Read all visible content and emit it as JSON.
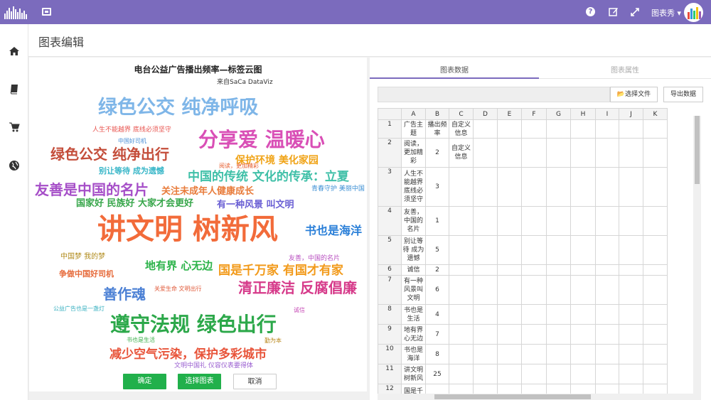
{
  "header": {
    "user_name": "图表秀",
    "help_icon": "question-circle-icon",
    "edit_icon": "edit-icon",
    "expand_icon": "expand-icon"
  },
  "sidebar": {
    "items": [
      {
        "icon": "home-icon"
      },
      {
        "icon": "book-icon"
      },
      {
        "icon": "cart-icon"
      },
      {
        "icon": "globe-icon"
      }
    ]
  },
  "page": {
    "title": "图表编辑"
  },
  "chart": {
    "title": "电台公益广告播出频率—标签云图",
    "subtitle": "来自SaCa DataViz"
  },
  "chart_data": {
    "type": "wordcloud",
    "title": "电台公益广告播出频率—标签云图",
    "words": [
      {
        "text": "绿色公交 纯净呼吸",
        "color": "#7fb6e8"
      },
      {
        "text": "人生不能越界 底线必须坚守",
        "color": "#e8544f"
      },
      {
        "text": "分享爱 温暖心",
        "color": "#d94fb6"
      },
      {
        "text": "中国好司机",
        "color": "#4a8fd6"
      },
      {
        "text": "绿色公交 纯净出行",
        "color": "#c44d3a"
      },
      {
        "text": "保护环境 美化家园",
        "color": "#f0a418"
      },
      {
        "text": "阅读，更加精彩",
        "color": "#e65e2f"
      },
      {
        "text": "别让等待 成为遗憾",
        "color": "#38b6c8"
      },
      {
        "text": "中国的传统 文化的传承：立夏",
        "color": "#40c0a8"
      },
      {
        "text": "友善是中国的名片",
        "color": "#a64fc8"
      },
      {
        "text": "关注未成年人健康成长",
        "color": "#e87b3a"
      },
      {
        "text": "青春守护 美丽中国",
        "color": "#3c8fd4"
      },
      {
        "text": "国家好 民族好 大家才会更好",
        "color": "#37a64a"
      },
      {
        "text": "有一种风景 叫文明",
        "color": "#6a5fd4"
      },
      {
        "text": "讲文明 树新风",
        "color": "#f26b3a"
      },
      {
        "text": "书也是海洋",
        "color": "#2a7fd8"
      },
      {
        "text": "中国梦 我的梦",
        "color": "#b08a1a"
      },
      {
        "text": "友善，中国的名片",
        "color": "#b84fc0"
      },
      {
        "text": "地有界 心无边",
        "color": "#2cb34a"
      },
      {
        "text": "国是千万家 有国才有家",
        "color": "#f29a1a"
      },
      {
        "text": "争做中国好司机",
        "color": "#e66a3a"
      },
      {
        "text": "清正廉洁 反腐倡廉",
        "color": "#d63a8a"
      },
      {
        "text": "关爱生命 文明出行",
        "color": "#e05a3a"
      },
      {
        "text": "善作魂",
        "color": "#4a7fd4"
      },
      {
        "text": "公益广告也是一盏灯",
        "color": "#38b0c0"
      },
      {
        "text": "诚信",
        "color": "#c850b8"
      },
      {
        "text": "遵守法规 绿色出行",
        "color": "#2ca84a"
      },
      {
        "text": "书也是生活",
        "color": "#3ab04a"
      },
      {
        "text": "勤为本",
        "color": "#b8861a"
      },
      {
        "text": "减少空气污染，保护多彩城市",
        "color": "#e8543a"
      },
      {
        "text": "文明中国礼 仪容仪表要得体",
        "color": "#9a5fd0"
      }
    ]
  },
  "buttons": {
    "ok": "确定",
    "select_chart": "选择图表",
    "cancel": "取消"
  },
  "data_panel": {
    "tab_data": "图表数据",
    "tab_props": "图表属性",
    "select_file": "选择文件",
    "export": "导出数据",
    "columns": [
      "A",
      "B",
      "C",
      "D",
      "E",
      "F",
      "G",
      "H",
      "I",
      "J",
      "K"
    ],
    "rows": [
      {
        "n": "1",
        "a": "广告主题",
        "b": "播出频率",
        "c": "自定义信息"
      },
      {
        "n": "2",
        "a": "阅读，更加精彩",
        "b": "2",
        "c": "自定义信息"
      },
      {
        "n": "3",
        "a": "人生不能越界底线必须坚守",
        "b": "3",
        "c": ""
      },
      {
        "n": "4",
        "a": "友善，中国的名片",
        "b": "1",
        "c": ""
      },
      {
        "n": "5",
        "a": "别让等待 成为遗憾",
        "b": "5",
        "c": ""
      },
      {
        "n": "6",
        "a": "诚信",
        "b": "2",
        "c": ""
      },
      {
        "n": "7",
        "a": "有一种风景叫文明",
        "b": "6",
        "c": ""
      },
      {
        "n": "8",
        "a": "书也是生活",
        "b": "4",
        "c": ""
      },
      {
        "n": "9",
        "a": "地有界心无边",
        "b": "7",
        "c": ""
      },
      {
        "n": "10",
        "a": "书也是海洋",
        "b": "8",
        "c": ""
      },
      {
        "n": "11",
        "a": "讲文明树新风",
        "b": "25",
        "c": ""
      },
      {
        "n": "12",
        "a": "国是千",
        "b": "",
        "c": ""
      }
    ]
  }
}
